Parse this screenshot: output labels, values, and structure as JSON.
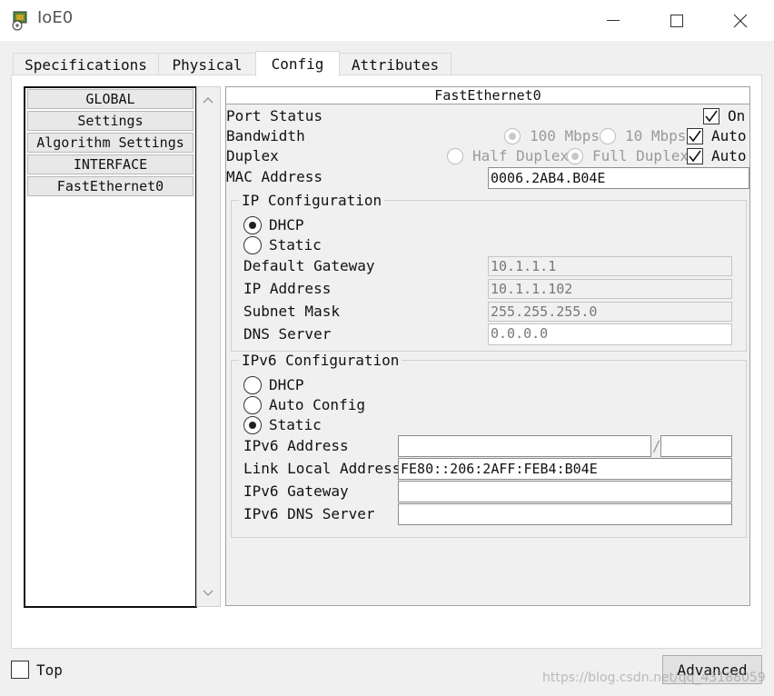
{
  "window": {
    "title": "IoE0"
  },
  "tabs": [
    {
      "label": "Specifications"
    },
    {
      "label": "Physical"
    },
    {
      "label": "Config"
    },
    {
      "label": "Attributes"
    }
  ],
  "sidebar": {
    "items": [
      {
        "label": "GLOBAL"
      },
      {
        "label": "Settings"
      },
      {
        "label": "Algorithm Settings"
      },
      {
        "label": "INTERFACE"
      },
      {
        "label": "FastEthernet0"
      }
    ]
  },
  "panel": {
    "title": "FastEthernet0",
    "port_status": {
      "label": "Port Status",
      "on_label": "On",
      "checked": true
    },
    "bandwidth": {
      "label": "Bandwidth",
      "opt_100": "100 Mbps",
      "opt_10": "10 Mbps",
      "auto_label": "Auto",
      "auto_checked": true
    },
    "duplex": {
      "label": "Duplex",
      "opt_half": "Half Duplex",
      "opt_full": "Full Duplex",
      "auto_label": "Auto",
      "auto_checked": true
    },
    "mac": {
      "label": "MAC Address",
      "value": "0006.2AB4.B04E"
    },
    "ip_config": {
      "title": "IP Configuration",
      "dhcp_label": "DHCP",
      "static_label": "Static",
      "selected": "DHCP",
      "gateway": {
        "label": "Default Gateway",
        "value": "10.1.1.1"
      },
      "ip": {
        "label": "IP Address",
        "value": "10.1.1.102"
      },
      "mask": {
        "label": "Subnet Mask",
        "value": "255.255.255.0"
      },
      "dns": {
        "label": "DNS Server",
        "value": "0.0.0.0"
      }
    },
    "ipv6_config": {
      "title": "IPv6 Configuration",
      "dhcp_label": "DHCP",
      "auto_label": "Auto Config",
      "static_label": "Static",
      "selected": "Static",
      "address": {
        "label": "IPv6 Address",
        "value": "",
        "prefix": "",
        "separator": "/"
      },
      "link_local": {
        "label": "Link Local Address:",
        "value": "FE80::206:2AFF:FEB4:B04E"
      },
      "gateway": {
        "label": "IPv6 Gateway",
        "value": ""
      },
      "dns": {
        "label": "IPv6 DNS Server",
        "value": ""
      }
    }
  },
  "footer": {
    "top_label": "Top",
    "top_checked": false,
    "advanced_label": "Advanced",
    "watermark": "https://blog.csdn.net/qq_43188059"
  }
}
